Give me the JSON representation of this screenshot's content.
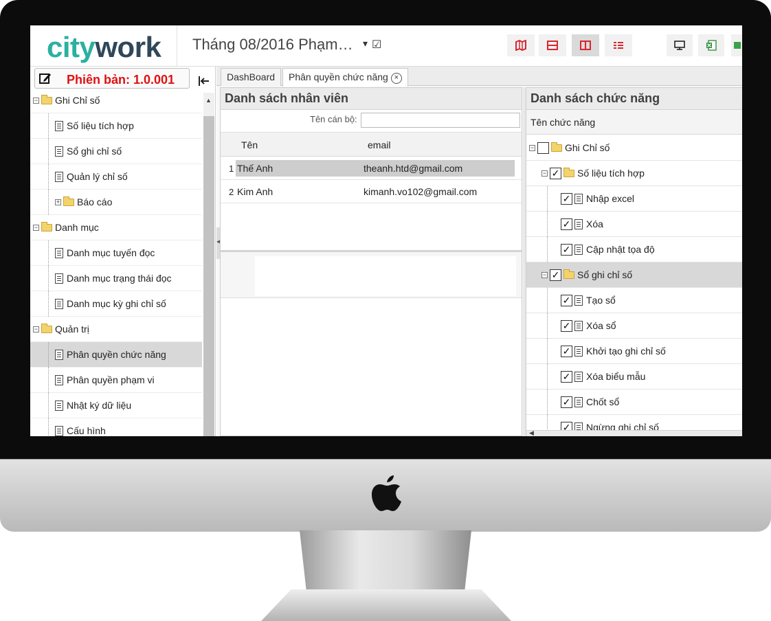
{
  "app": {
    "logo_part1": "city",
    "logo_part2": "work",
    "period": "Tháng 08/2016 Phạm…",
    "period_caret": "▾",
    "period_check": "☑",
    "accent_color": "#2bb0a1",
    "dark_color": "#2f4759",
    "layout_icon_color": "#d9262e"
  },
  "sidebar": {
    "version_label": "Phiên bản: 1.0.001",
    "tree": [
      {
        "label": "Ghi Chỉ số",
        "type": "folder",
        "level": 0,
        "toggle": "⊟"
      },
      {
        "label": "Số liệu tích hợp",
        "type": "doc",
        "level": 1
      },
      {
        "label": "Sổ ghi chỉ số",
        "type": "doc",
        "level": 1
      },
      {
        "label": "Quản lý chỉ số",
        "type": "doc",
        "level": 1
      },
      {
        "label": "Báo cáo",
        "type": "folder",
        "level": 1,
        "toggle": "⊞"
      },
      {
        "label": "Danh mục",
        "type": "folder",
        "level": 0,
        "toggle": "⊟"
      },
      {
        "label": "Danh mục tuyến đọc",
        "type": "doc",
        "level": 1
      },
      {
        "label": "Danh mục trạng thái đọc",
        "type": "doc",
        "level": 1
      },
      {
        "label": "Danh mục kỳ ghi chỉ số",
        "type": "doc",
        "level": 1
      },
      {
        "label": "Quản trị",
        "type": "folder",
        "level": 0,
        "toggle": "⊟"
      },
      {
        "label": "Phân quyền chức năng",
        "type": "doc",
        "level": 1,
        "selected": true
      },
      {
        "label": "Phân quyền phạm vi",
        "type": "doc",
        "level": 1
      },
      {
        "label": "Nhật ký dữ liệu",
        "type": "doc",
        "level": 1
      },
      {
        "label": "Cấu hình",
        "type": "doc",
        "level": 1
      }
    ]
  },
  "tabs": [
    {
      "label": "DashBoard",
      "active": false
    },
    {
      "label": "Phân quyền chức năng",
      "active": true,
      "close": "×"
    }
  ],
  "employees": {
    "title": "Danh sách nhân viên",
    "filter_label": "Tên cán bộ:",
    "filter_value": "",
    "columns": [
      "Tên",
      "email"
    ],
    "rows": [
      {
        "num": "1",
        "name": "Thế Anh",
        "email": "theanh.htd@gmail.com",
        "selected": true
      },
      {
        "num": "2",
        "name": "Kim Anh",
        "email": "kimanh.vo102@gmail.com",
        "selected": false
      }
    ]
  },
  "functions": {
    "title": "Danh sách chức năng",
    "column": "Tên chức năng",
    "rows": [
      {
        "label": "Ghi Chỉ số",
        "type": "folder",
        "level": 0,
        "toggle": "⊟",
        "checked": false
      },
      {
        "label": "Số liệu tích hợp",
        "type": "folder",
        "level": 1,
        "toggle": "⊟",
        "checked": true
      },
      {
        "label": "Nhập excel",
        "type": "doc",
        "level": 2,
        "checked": true
      },
      {
        "label": "Xóa",
        "type": "doc",
        "level": 2,
        "checked": true
      },
      {
        "label": "Cập nhật tọa độ",
        "type": "doc",
        "level": 2,
        "checked": true
      },
      {
        "label": "Sổ ghi chỉ số",
        "type": "folder",
        "level": 1,
        "toggle": "⊟",
        "checked": true,
        "selected": true
      },
      {
        "label": "Tạo sổ",
        "type": "doc",
        "level": 2,
        "checked": true
      },
      {
        "label": "Xóa sổ",
        "type": "doc",
        "level": 2,
        "checked": true
      },
      {
        "label": "Khởi tạo ghi chỉ số",
        "type": "doc",
        "level": 2,
        "checked": true
      },
      {
        "label": "Xóa biểu mẫu",
        "type": "doc",
        "level": 2,
        "checked": true
      },
      {
        "label": "Chốt sổ",
        "type": "doc",
        "level": 2,
        "checked": true
      },
      {
        "label": "Ngừng ghi chỉ số",
        "type": "doc",
        "level": 2,
        "checked": true
      }
    ]
  }
}
